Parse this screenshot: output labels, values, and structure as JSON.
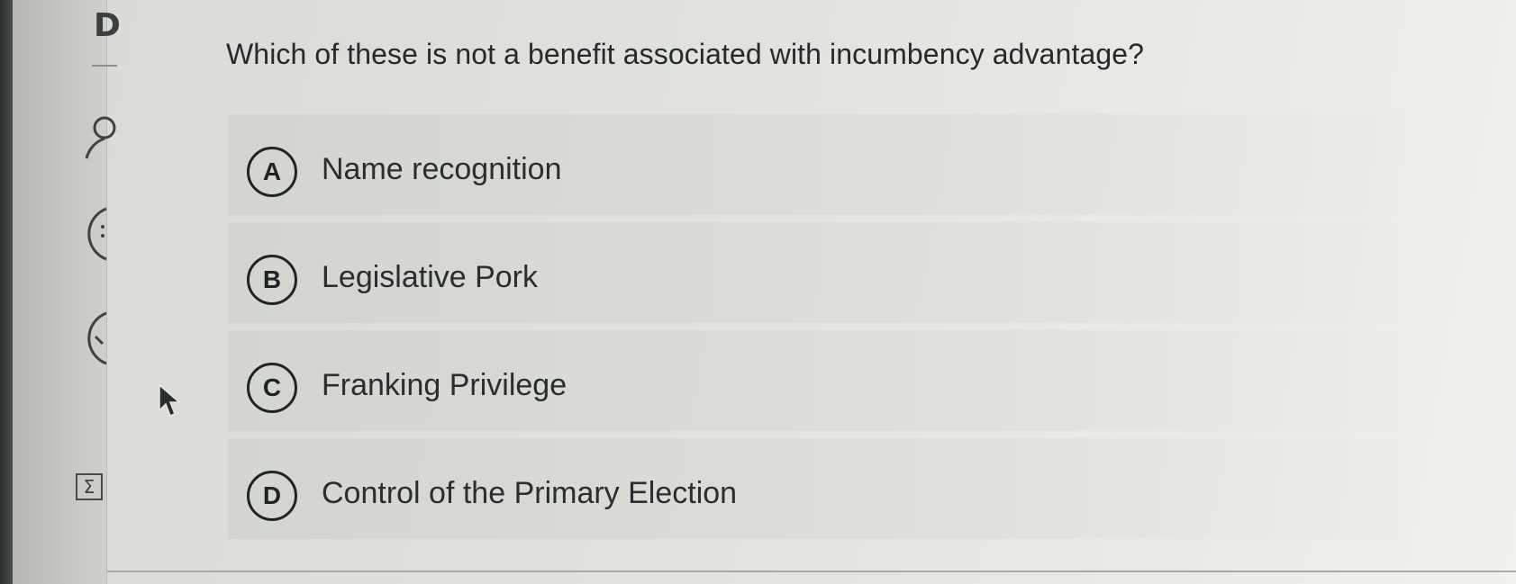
{
  "sidebar": {
    "top_letter": "D",
    "icons": [
      "person-icon",
      "clock-icon",
      "check-circle-icon",
      "sigma-icon"
    ]
  },
  "question": {
    "text": "Which of these is not a benefit associated with incumbency advantage?"
  },
  "options": [
    {
      "letter": "A",
      "label": "Name recognition"
    },
    {
      "letter": "B",
      "label": "Legislative Pork"
    },
    {
      "letter": "C",
      "label": "Franking Privilege"
    },
    {
      "letter": "D",
      "label": "Control of the Primary Election"
    }
  ],
  "colors": {
    "text": "#262a2b",
    "background": "#e1e2dd",
    "sidebar": "#c5c7c2"
  }
}
